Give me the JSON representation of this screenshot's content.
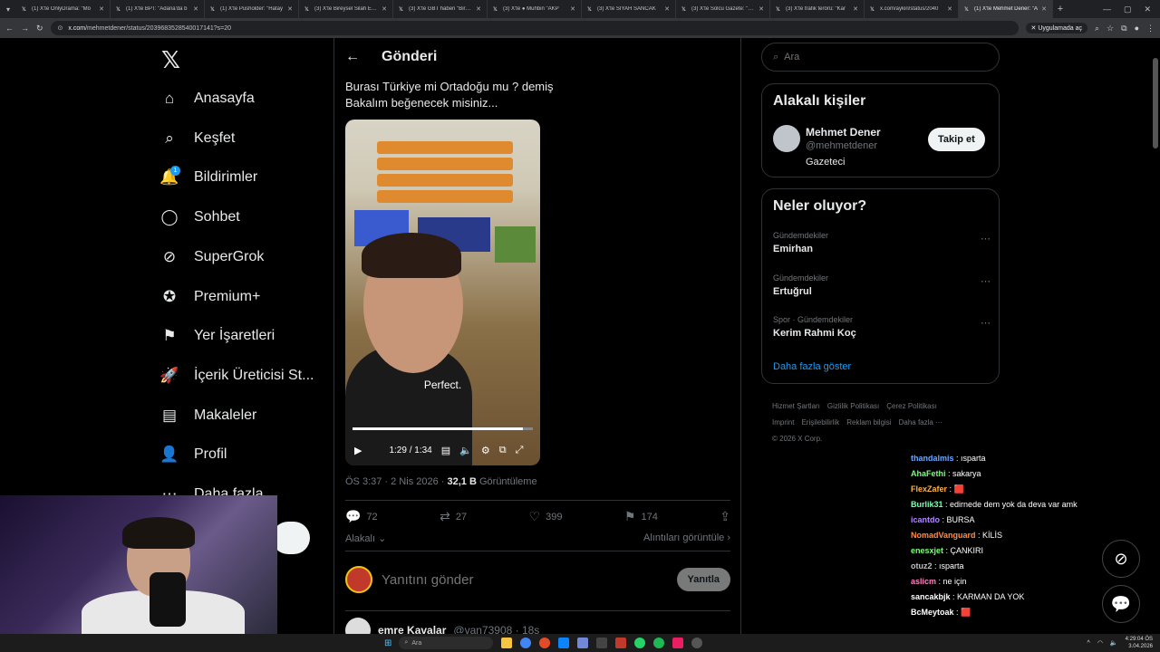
{
  "browser": {
    "tabs": [
      {
        "label": "(1) X'te OnlyDrama: \"Mö"
      },
      {
        "label": "(1) X'te BPT: \"Adana'da b"
      },
      {
        "label": "(1) X'te Pusholder: \"Hatay"
      },
      {
        "label": "(3) X'te Bireysel Silah Edin"
      },
      {
        "label": "(3) X'te GBT haberi \"Bir ka"
      },
      {
        "label": "(3) X'te ● Muhbin \"AKP"
      },
      {
        "label": "(3) X'te SİYAH SANCAK"
      },
      {
        "label": "(3) X'te Solcu Gazete: \"Ge"
      },
      {
        "label": "(3) X'te trafik terörü: \"Kar"
      },
      {
        "label": "x.com/aykiri/status/2040"
      },
      {
        "label": "(1) X'te Mehmet Dener: \"A"
      }
    ],
    "url_host": "x.com",
    "url_path": "/mehmetdener/status/2039683528540017141?s=20",
    "app_button": "Uygulamada aç"
  },
  "nav": {
    "items": [
      {
        "label": "Anasayfa",
        "icon": "home-icon"
      },
      {
        "label": "Keşfet",
        "icon": "search-icon"
      },
      {
        "label": "Bildirimler",
        "icon": "bell-icon"
      },
      {
        "label": "Sohbet",
        "icon": "chat-icon"
      },
      {
        "label": "SuperGrok",
        "icon": "grok-icon"
      },
      {
        "label": "Premium+",
        "icon": "verified-icon"
      },
      {
        "label": "Yer İşaretleri",
        "icon": "bookmark-icon"
      },
      {
        "label": "İçerik Üreticisi St...",
        "icon": "rocket-icon"
      },
      {
        "label": "Makaleler",
        "icon": "article-icon"
      },
      {
        "label": "Profil",
        "icon": "profile-icon"
      },
      {
        "label": "Daha fazla",
        "icon": "more-icon"
      }
    ],
    "notif_badge": "1"
  },
  "post": {
    "header": "Gönderi",
    "text_line1": "Burası Türkiye mi Ortadoğu mu ? demiş",
    "text_line2": "Bakalım beğenecek misiniz...",
    "video_caption": "Perfect.",
    "video_time": "1:29 / 1:34",
    "video_progress": 0.947,
    "time": "ÖS 3:37 · 2 Nis 2026 · ",
    "views": "32,1 B",
    "views_label": " Görüntüleme",
    "replies": "72",
    "reposts": "27",
    "likes": "399",
    "bookmarks": "174",
    "relevant": "Alakalı",
    "quotes": "Alıntıları görüntüle",
    "reply_placeholder": "Yanıtını gönder",
    "reply_button": "Yanıtla",
    "next_name": "emre Kavalar",
    "next_handle": "@van73908 · 18s"
  },
  "right": {
    "search_placeholder": "Ara",
    "related_title": "Alakalı kişiler",
    "person_name": "Mehmet Dener",
    "person_handle": "@mehmetdener",
    "person_bio": "Gazeteci",
    "follow": "Takip et",
    "trends_title": "Neler oluyor?",
    "trends": [
      {
        "cat": "Gündemdekiler",
        "name": "Emirhan"
      },
      {
        "cat": "Gündemdekiler",
        "name": "Ertuğrul"
      },
      {
        "cat": "Spor · Gündemdekiler",
        "name": "Kerim Rahmi Koç"
      }
    ],
    "show_more": "Daha fazla göster",
    "footer1": [
      "Hizmet Şartları",
      "Gizlilik Politikası",
      "Çerez Politikası"
    ],
    "footer2": [
      "Imprint",
      "Erişilebilirlik",
      "Reklam bilgisi",
      "Daha fazla ···"
    ],
    "copyright": "© 2026 X Corp."
  },
  "chat": [
    {
      "user": "thandalmis",
      "msg": "ısparta",
      "color": "#6aa8ff"
    },
    {
      "user": "AhaFethi",
      "msg": "sakarya",
      "color": "#7cfc7c"
    },
    {
      "user": "FlexZafer",
      "msg": "🟥",
      "color": "#ffb347"
    },
    {
      "user": "Burlik31",
      "msg": "edirnede dem yok da deva var amk",
      "color": "#7cfcb0"
    },
    {
      "user": "icantdo",
      "msg": "BURSA",
      "color": "#b388ff"
    },
    {
      "user": "NomadVanguard",
      "msg": "KİLİS",
      "color": "#ff8c42"
    },
    {
      "user": "enesxjet",
      "msg": "ÇANKIRI",
      "color": "#7cfc7c"
    },
    {
      "user": "otuz2",
      "msg": "ısparta",
      "color": "#c0c0c0"
    },
    {
      "user": "aslicm",
      "msg": "ne için",
      "color": "#ff80c0"
    },
    {
      "user": "sancakbjk",
      "msg": "KARMAN DA YOK",
      "color": "#ffffff"
    },
    {
      "user": "BcMeytoak",
      "msg": "🟥",
      "color": "#ffffff"
    }
  ],
  "taskbar": {
    "search": "Ara",
    "time": "4:29:04 ÖS",
    "date": "3.04.2026"
  }
}
